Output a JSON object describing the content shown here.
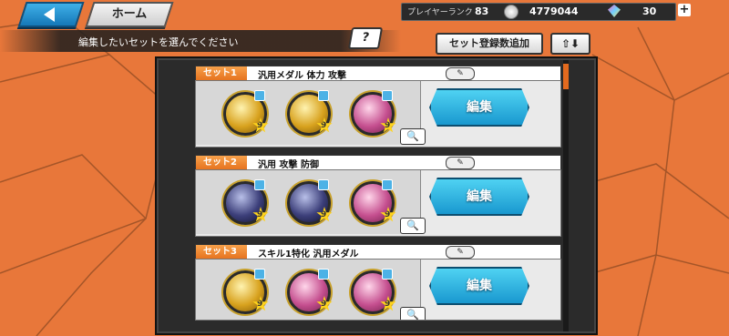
{
  "top_bar": {
    "home_label": "ホーム",
    "player_rank_label": "プレイヤーランク",
    "player_rank_value": "83",
    "coins_value": "4779044",
    "gems_value": "30",
    "plus_symbol": "+"
  },
  "subheader": {
    "instruction": "編集したいセットを選んでください",
    "help_label": "?",
    "add_count_label": "セット登録数追加",
    "sort_label": "⇧⬇"
  },
  "sets": [
    {
      "tag": "セット1",
      "name": "汎用メダル 体力 攻撃",
      "edit_label": "編集",
      "medals": [
        {
          "style": "gold",
          "stars": "9"
        },
        {
          "style": "gold",
          "stars": "9"
        },
        {
          "style": "pink",
          "stars": "9"
        }
      ]
    },
    {
      "tag": "セット2",
      "name": "汎用 攻撃 防御",
      "edit_label": "編集",
      "medals": [
        {
          "style": "dark",
          "stars": "9"
        },
        {
          "style": "dark",
          "stars": "9"
        },
        {
          "style": "pink",
          "stars": "9"
        }
      ]
    },
    {
      "tag": "セット3",
      "name": "スキル1特化 汎用メダル",
      "edit_label": "編集",
      "medals": [
        {
          "style": "gold",
          "stars": "9"
        },
        {
          "style": "pink",
          "stars": "9"
        },
        {
          "style": "pink",
          "stars": "9"
        }
      ]
    }
  ],
  "colors": {
    "background": "#e8773a",
    "accent_orange": "#e5711d",
    "edit_button": "#1998cf"
  }
}
